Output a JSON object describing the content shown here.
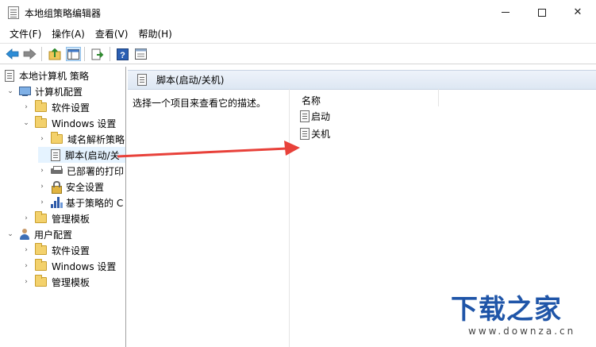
{
  "window": {
    "title": "本地组策略编辑器"
  },
  "menu": [
    "文件(F)",
    "操作(A)",
    "查看(V)",
    "帮助(H)"
  ],
  "toolbar": {
    "icons": [
      "back-icon",
      "forward-icon",
      "up-folder-icon",
      "show-hide-tree-icon",
      "export-list-icon",
      "help-icon",
      "properties-icon"
    ]
  },
  "tree": {
    "root": "本地计算机 策略",
    "computer_config": "计算机配置",
    "software_settings": "软件设置",
    "windows_settings": "Windows 设置",
    "name_resolution_policy": "域名解析策略",
    "scripts": "脚本(启动/关",
    "deployed_printers": "已部署的打印",
    "security_settings": "安全设置",
    "policy_based_qos": "基于策略的 C",
    "admin_templates": "管理模板",
    "user_config": "用户配置",
    "user_software_settings": "软件设置",
    "user_windows_settings": "Windows 设置",
    "user_admin_templates": "管理模板"
  },
  "right": {
    "header": "脚本(启动/关机)",
    "description": "选择一个项目来查看它的描述。",
    "column_name": "名称",
    "items": [
      "启动",
      "关机"
    ]
  },
  "annotation": {
    "arrow_color": "#e8413a"
  },
  "watermark": {
    "title": "下载之家",
    "url": "www.downza.cn"
  },
  "colors": {
    "header_bg": "#dde7f3",
    "selection": "#e5f3ff",
    "watermark": "#1f55a8"
  }
}
